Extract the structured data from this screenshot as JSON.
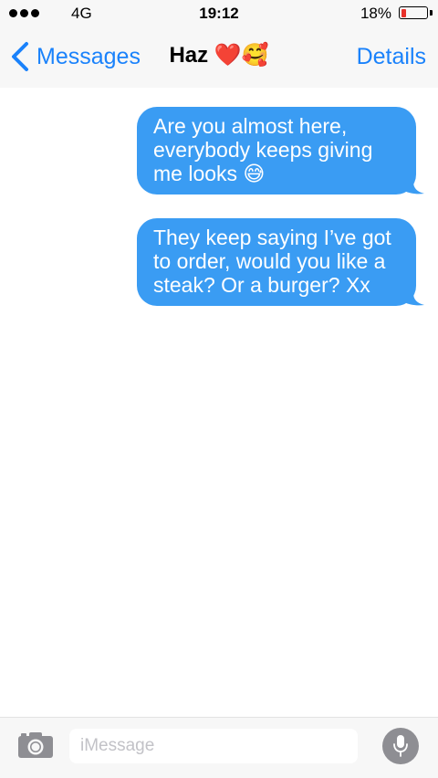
{
  "status_bar": {
    "network": "4G",
    "time": "19:12",
    "battery_percent": "18%",
    "battery_level": 0.18,
    "battery_color": "#e8302a"
  },
  "nav": {
    "back_label": "Messages",
    "contact_name": "Haz",
    "contact_emojis": "❤️🥰",
    "details_label": "Details"
  },
  "messages": [
    {
      "direction": "outgoing",
      "text": "Are you almost here, everybody keeps giving me looks 😅"
    },
    {
      "direction": "outgoing",
      "text": "They keep saying I’ve got to order, would you like a steak? Or a burger? Xx"
    }
  ],
  "input_bar": {
    "placeholder": "iMessage",
    "camera_icon": "camera-icon",
    "mic_icon": "microphone-icon"
  },
  "colors": {
    "accent": "#1a82fb",
    "bubble": "#3a9cf3",
    "bar_background": "#f7f7f7"
  }
}
